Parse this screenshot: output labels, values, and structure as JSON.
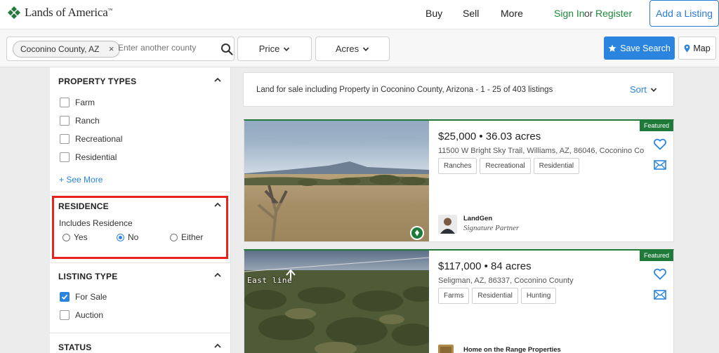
{
  "brand": {
    "name": "Lands of America",
    "trademark": "™",
    "accent": "#1d8a3c"
  },
  "nav": {
    "buy": "Buy",
    "sell": "Sell",
    "more": "More",
    "sign_in": "Sign In",
    "or": "or",
    "register": "Register",
    "add_listing": "Add a Listing"
  },
  "search": {
    "chip_label": "Coconino County, AZ",
    "chip_remove": "×",
    "placeholder": "Enter another county",
    "price_label": "Price",
    "acres_label": "Acres",
    "save_search_label": "Save Search",
    "map_label": "Map",
    "primary_color": "#2b85de"
  },
  "sidebar": {
    "property_types": {
      "title": "PROPERTY TYPES",
      "items": [
        {
          "label": "Farm",
          "checked": false
        },
        {
          "label": "Ranch",
          "checked": false
        },
        {
          "label": "Recreational",
          "checked": false
        },
        {
          "label": "Residential",
          "checked": false
        }
      ],
      "see_more": "+ See More"
    },
    "residence": {
      "title": "RESIDENCE",
      "label": "Includes Residence",
      "options": [
        {
          "label": "Yes",
          "selected": false
        },
        {
          "label": "No",
          "selected": true
        },
        {
          "label": "Either",
          "selected": false
        }
      ],
      "highlight_color": "#e8231d"
    },
    "listing_type": {
      "title": "LISTING TYPE",
      "items": [
        {
          "label": "For Sale",
          "checked": true
        },
        {
          "label": "Auction",
          "checked": false
        }
      ]
    },
    "status": {
      "title": "STATUS"
    }
  },
  "results": {
    "summary": "Land for sale including Property in Coconino County, Arizona - 1 - 25 of 403 listings",
    "sort_label": "Sort"
  },
  "listings": [
    {
      "badge": "Featured",
      "price_line": "$25,000 • 36.03 acres",
      "address": "11500 W Bright Sky Trail, Williams, AZ, 86046, Coconino Co",
      "tags": [
        "Ranches",
        "Recreational",
        "Residential"
      ],
      "agent_name": "LandGen",
      "agent_sub": "Signature Partner"
    },
    {
      "badge": "Featured",
      "price_line": "$117,000 • 84 acres",
      "address": "Seligman, AZ, 86337, Coconino County",
      "tags": [
        "Farms",
        "Residential",
        "Hunting"
      ],
      "agent_name": "Home on the Range Properties",
      "photo_caption": "East line"
    }
  ]
}
